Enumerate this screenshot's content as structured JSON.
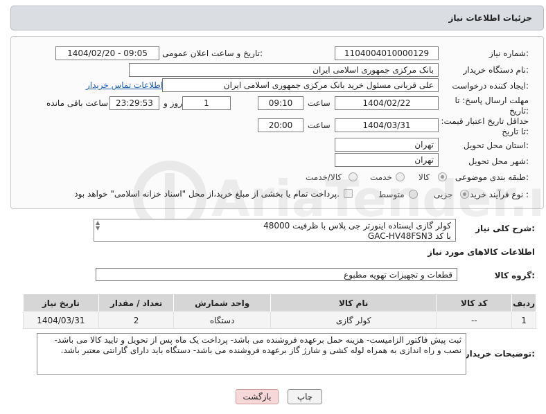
{
  "header": {
    "title": "جزئیات اطلاعات نیاز"
  },
  "fields": {
    "need_number_label": "شماره نیاز:",
    "need_number": "1104004010000129",
    "announce_label": "تاریخ و ساعت اعلان عمومی:",
    "announce_value": "1404/02/20 - 09:05",
    "buyer_org_label": "نام دستگاه خریدار:",
    "buyer_org": "بانک مرکزی جمهوری اسلامی ایران",
    "creator_label": "ایجاد کننده درخواست:",
    "creator": "علی قربانی مسئول خرید بانک مرکزی جمهوری اسلامی ایران",
    "contact_link": "اطلاعات تماس خریدار",
    "reply_deadline_label": "مهلت ارسال پاسخ: تا تاریخ:",
    "reply_date": "1404/02/22",
    "time_label": "ساعت",
    "reply_time": "09:10",
    "days_value": "1",
    "days_label": "روز و",
    "remaining_time": "23:29:53",
    "remaining_label": "ساعت باقی مانده",
    "price_validity_label": "حداقل تاریخ اعتبار قیمت: تا تاریخ:",
    "price_date": "1404/03/31",
    "price_time_label": "ساعت",
    "price_time": "20:00",
    "province_label": "استان محل تحویل:",
    "province": "تهران",
    "city_label": "شهر محل تحویل:",
    "city": "تهران",
    "category_label": "طبقه بندی موضوعی:",
    "category_options": [
      "کالا",
      "خدمت",
      "کالا/خدمت"
    ],
    "purchase_type_label": "نوع فرآیند خرید :",
    "purchase_options": [
      "جزیی",
      "متوسط"
    ],
    "payment_note": "پرداخت تمام یا بخشی از مبلغ خرید،از محل \"اسناد خزانه اسلامی\" خواهد بود."
  },
  "description": {
    "label": "شرح کلی نیاز:",
    "text_line1": "کولر گازی ایستاده اینورتر جی پلاس با ظرفیت 48000",
    "text_line2": "با کد GAC-HV48FSN3"
  },
  "goods_info": {
    "title": "اطلاعات کالاهای مورد نیاز",
    "group_label": "گروه کالا:",
    "group_value": "قطعات و تجهیزات تهویه مطبوع"
  },
  "table": {
    "headers": [
      "ردیف",
      "کد کالا",
      "نام کالا",
      "واحد شمارش",
      "تعداد / مقدار",
      "تاریخ نیاز"
    ],
    "rows": [
      [
        "1",
        "--",
        "کولر گازی",
        "دستگاه",
        "2",
        "1404/03/31"
      ]
    ]
  },
  "buyer_notes": {
    "label": "توضیحات خریدار:",
    "text": "ثبت پیش فاکتور الزامیست- هزینه حمل برعهده فروشنده می باشد- پرداخت یک ماه پس از تحویل و تایید کالا می باشد- نصب و راه اندازی به همراه لوله کشی و شارژ گاز برعهده فروشنده می باشد- دستگاه باید دارای گارانتی معتبر باشد."
  },
  "buttons": {
    "print": "چاپ",
    "back": "بازگشت"
  },
  "watermark": {
    "text": "AriaTender.net"
  },
  "colors": {
    "header_bg": "#dadde2",
    "link": "#1a5fb4",
    "back_button": "#f7d8d8"
  }
}
